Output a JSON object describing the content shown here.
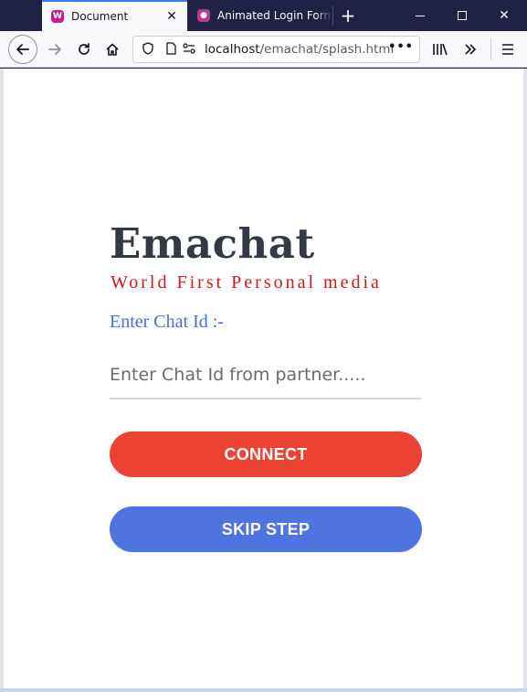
{
  "browser": {
    "tabs": [
      {
        "title": "Document",
        "favicon": "webassembly-like-icon",
        "active": true
      },
      {
        "title": "Animated Login Form",
        "favicon": "app-icon",
        "active": false
      }
    ],
    "url": {
      "host": "localhost",
      "path": "/emachat/splash.html"
    },
    "accent_color": "#3b7af5",
    "chrome_color": "#1f2244"
  },
  "page": {
    "brand": "Emachat",
    "tagline": "World First Personal media",
    "chat_id_label": "Enter Chat Id :-",
    "chat_id_value": "",
    "chat_id_placeholder": "Enter Chat Id from partner.....",
    "connect_label": "CONNECT",
    "skip_label": "SKIP STEP",
    "colors": {
      "brand": "#333a46",
      "tagline": "#cc1a1a",
      "label": "#4a6fd1",
      "connect": "#ea4335",
      "skip": "#4e74e0"
    }
  }
}
